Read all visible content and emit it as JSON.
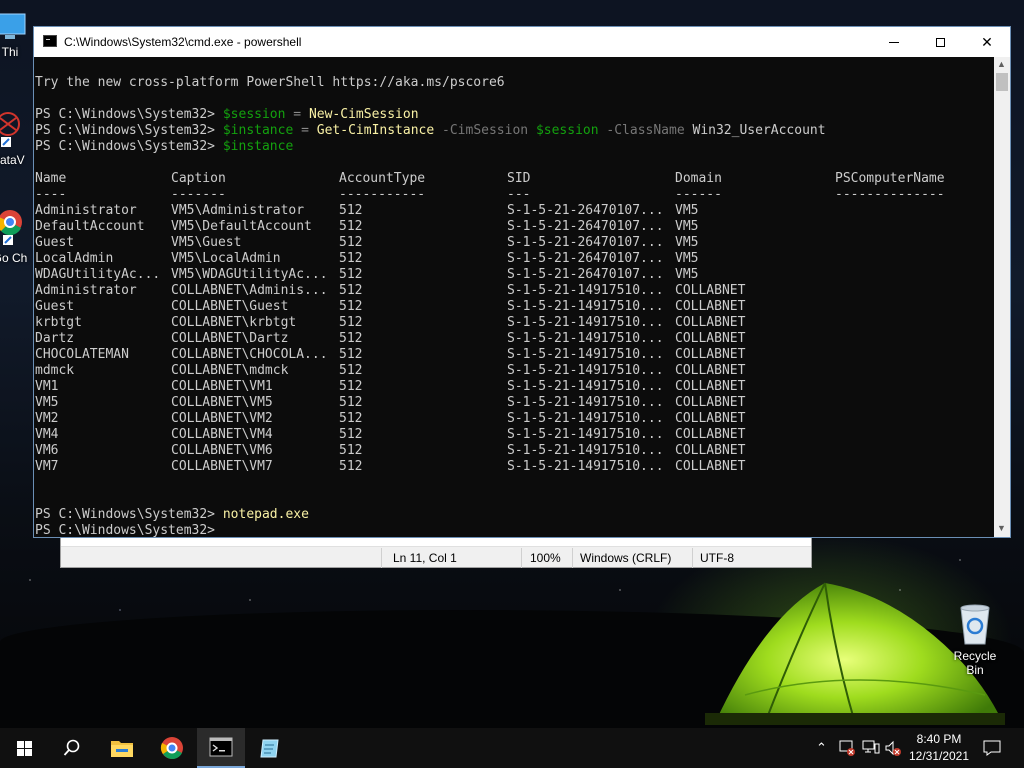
{
  "desktop": {
    "icons": [
      {
        "label": "Thi"
      },
      {
        "label": "DataV"
      },
      {
        "label": "Go Ch"
      },
      {
        "label": "Recycle Bin"
      }
    ]
  },
  "notepad_status": {
    "position": "Ln 11, Col 1",
    "zoom": "100%",
    "line_ending": "Windows (CRLF)",
    "encoding": "UTF-8"
  },
  "window": {
    "title": "C:\\Windows\\System32\\cmd.exe - powershell",
    "minimize": "minimize",
    "maximize": "maximize",
    "close": "✕"
  },
  "terminal": {
    "banner": "Try the new cross-platform PowerShell https://aka.ms/pscore6",
    "prompt": "PS C:\\Windows\\System32>",
    "cmd1": {
      "var": "$session",
      "op": "=",
      "cmd": "New-CimSession"
    },
    "cmd2": {
      "var": "$instance",
      "op": "=",
      "cmd": "Get-CimInstance",
      "p1": "-CimSession",
      "p1v": "$session",
      "p2": "-ClassName",
      "p2v": "Win32_UserAccount"
    },
    "cmd3": {
      "var": "$instance"
    },
    "headers": [
      "Name",
      "Caption",
      "AccountType",
      "SID",
      "Domain",
      "PSComputerName"
    ],
    "underlines": [
      "----",
      "-------",
      "-----------",
      "---",
      "------",
      "--------------"
    ],
    "rows": [
      [
        "Administrator",
        "VM5\\Administrator",
        "512",
        "S-1-5-21-26470107...",
        "VM5"
      ],
      [
        "DefaultAccount",
        "VM5\\DefaultAccount",
        "512",
        "S-1-5-21-26470107...",
        "VM5"
      ],
      [
        "Guest",
        "VM5\\Guest",
        "512",
        "S-1-5-21-26470107...",
        "VM5"
      ],
      [
        "LocalAdmin",
        "VM5\\LocalAdmin",
        "512",
        "S-1-5-21-26470107...",
        "VM5"
      ],
      [
        "WDAGUtilityAc...",
        "VM5\\WDAGUtilityAc...",
        "512",
        "S-1-5-21-26470107...",
        "VM5"
      ],
      [
        "Administrator",
        "COLLABNET\\Adminis...",
        "512",
        "S-1-5-21-14917510...",
        "COLLABNET"
      ],
      [
        "Guest",
        "COLLABNET\\Guest",
        "512",
        "S-1-5-21-14917510...",
        "COLLABNET"
      ],
      [
        "krbtgt",
        "COLLABNET\\krbtgt",
        "512",
        "S-1-5-21-14917510...",
        "COLLABNET"
      ],
      [
        "Dartz",
        "COLLABNET\\Dartz",
        "512",
        "S-1-5-21-14917510...",
        "COLLABNET"
      ],
      [
        "CHOCOLATEMAN",
        "COLLABNET\\CHOCOLA...",
        "512",
        "S-1-5-21-14917510...",
        "COLLABNET"
      ],
      [
        "mdmck",
        "COLLABNET\\mdmck",
        "512",
        "S-1-5-21-14917510...",
        "COLLABNET"
      ],
      [
        "VM1",
        "COLLABNET\\VM1",
        "512",
        "S-1-5-21-14917510...",
        "COLLABNET"
      ],
      [
        "VM5",
        "COLLABNET\\VM5",
        "512",
        "S-1-5-21-14917510...",
        "COLLABNET"
      ],
      [
        "VM2",
        "COLLABNET\\VM2",
        "512",
        "S-1-5-21-14917510...",
        "COLLABNET"
      ],
      [
        "VM4",
        "COLLABNET\\VM4",
        "512",
        "S-1-5-21-14917510...",
        "COLLABNET"
      ],
      [
        "VM6",
        "COLLABNET\\VM6",
        "512",
        "S-1-5-21-14917510...",
        "COLLABNET"
      ],
      [
        "VM7",
        "COLLABNET\\VM7",
        "512",
        "S-1-5-21-14917510...",
        "COLLABNET"
      ]
    ],
    "cmd4": {
      "text": "notepad.exe"
    }
  },
  "taskbar": {
    "time": "8:40 PM",
    "date": "12/31/2021",
    "active_app": "cmd.exe"
  }
}
